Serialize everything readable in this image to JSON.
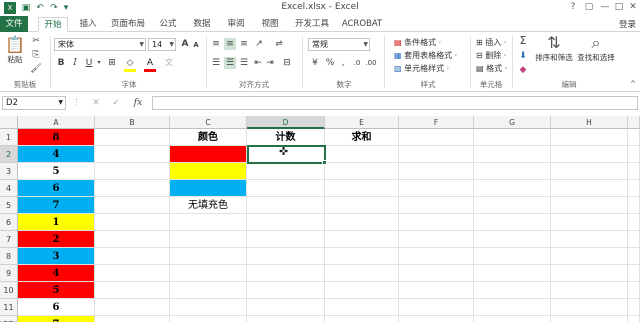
{
  "window": {
    "title": "Excel.xlsx - Excel",
    "controls": [
      "?",
      "▢",
      "—",
      "□",
      "✕"
    ]
  },
  "qat": [
    "save-icon",
    "undo-icon",
    "redo-icon"
  ],
  "tabs": [
    "文件",
    "开始",
    "插入",
    "页面布局",
    "公式",
    "数据",
    "审阅",
    "视图",
    "开发工具",
    "ACROBAT"
  ],
  "signin": "登录",
  "ribbon": {
    "clipboard": {
      "paste": "粘贴",
      "label": "剪贴板"
    },
    "font": {
      "name": "宋体",
      "size": "14",
      "bold": "B",
      "italic": "I",
      "underline": "U",
      "font_color_sample": "A",
      "label": "字体"
    },
    "alignment": {
      "label": "对齐方式"
    },
    "number": {
      "format": "常规",
      "label": "数字"
    },
    "styles": {
      "conditional": "条件格式 ·",
      "table": "套用表格格式 ·",
      "cell": "单元格样式 ·",
      "label": "样式"
    },
    "cells": {
      "insert": "插入 ·",
      "delete": "删除 ·",
      "format": "格式 ·",
      "label": "单元格"
    },
    "editing": {
      "sort": "排序和筛选",
      "find": "查找和选择",
      "label": "编辑"
    }
  },
  "formula_bar": {
    "name_box": "D2",
    "fx": "fx",
    "cancel": "✕",
    "confirm": "✓",
    "content": ""
  },
  "grid": {
    "selected_cell": "D2",
    "columns": [
      "A",
      "B",
      "C",
      "D",
      "E",
      "F",
      "G",
      "H"
    ],
    "rows": [
      "1",
      "2",
      "3",
      "4",
      "5",
      "6",
      "7",
      "8",
      "9",
      "10",
      "11",
      "12"
    ],
    "col_a": [
      {
        "value": "8",
        "fill": "#FF0000"
      },
      {
        "value": "4",
        "fill": "#00B0F0"
      },
      {
        "value": "5",
        "fill": "#FFFFFF"
      },
      {
        "value": "6",
        "fill": "#00B0F0"
      },
      {
        "value": "7",
        "fill": "#00B0F0"
      },
      {
        "value": "1",
        "fill": "#FFFF00"
      },
      {
        "value": "2",
        "fill": "#FF0000"
      },
      {
        "value": "3",
        "fill": "#00B0F0"
      },
      {
        "value": "4",
        "fill": "#FF0000"
      },
      {
        "value": "5",
        "fill": "#FF0000"
      },
      {
        "value": "6",
        "fill": "#FFFFFF"
      },
      {
        "value": "7",
        "fill": "#FFFF00"
      }
    ],
    "headers": {
      "c1": "颜色",
      "d1": "计数",
      "e1": "求和"
    },
    "color_samples": [
      "#FF0000",
      "#FFFF00",
      "#00B0F0"
    ],
    "no_fill_label": "无填充色"
  }
}
